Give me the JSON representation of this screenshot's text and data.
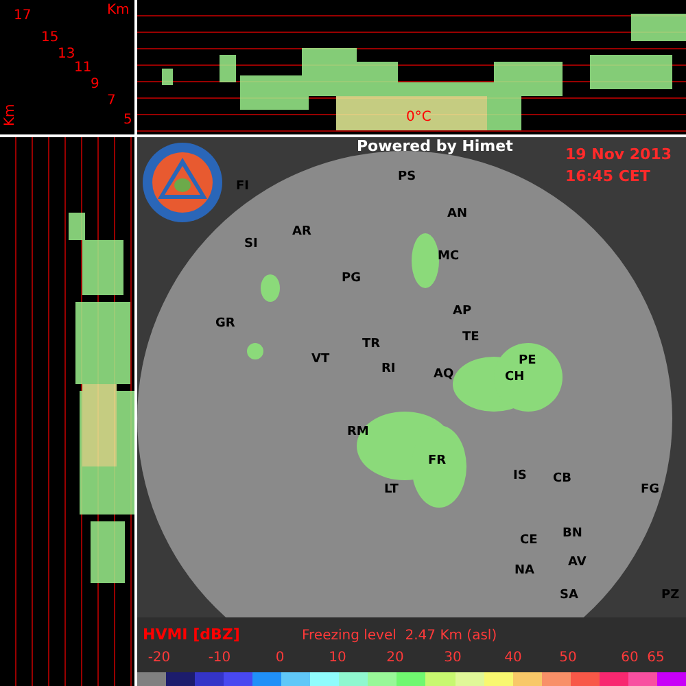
{
  "height_axis": {
    "unit": "Km",
    "side_unit": "Km",
    "labels": [
      "17",
      "15",
      "13",
      "11",
      "9",
      "7",
      "5"
    ]
  },
  "top_panel": {
    "freezing_marker": "0°C"
  },
  "map": {
    "credit": "Powered by Himet",
    "date": "19 Nov 2013",
    "time": "16:45 CET",
    "cities": [
      {
        "name": "FI"
      },
      {
        "name": "PS"
      },
      {
        "name": "AN"
      },
      {
        "name": "SI"
      },
      {
        "name": "AR"
      },
      {
        "name": "MC"
      },
      {
        "name": "PG"
      },
      {
        "name": "AP"
      },
      {
        "name": "GR"
      },
      {
        "name": "TE"
      },
      {
        "name": "TR"
      },
      {
        "name": "PE"
      },
      {
        "name": "VT"
      },
      {
        "name": "RI"
      },
      {
        "name": "AQ"
      },
      {
        "name": "CH"
      },
      {
        "name": "RM"
      },
      {
        "name": "FR"
      },
      {
        "name": "IS"
      },
      {
        "name": "CB"
      },
      {
        "name": "FG"
      },
      {
        "name": "LT"
      },
      {
        "name": "CE"
      },
      {
        "name": "BN"
      },
      {
        "name": "NA"
      },
      {
        "name": "AV"
      },
      {
        "name": "SA"
      },
      {
        "name": "PZ"
      }
    ]
  },
  "legend": {
    "product": "HVMI [dBZ]",
    "freezing_level": "Freezing level  2.47 Km (asl)",
    "ticks": [
      "-20",
      "-10",
      "0",
      "10",
      "20",
      "30",
      "40",
      "50",
      "60",
      "65"
    ],
    "segments": [
      {
        "color": "#808080"
      },
      {
        "color": "#1c1c6c"
      },
      {
        "color": "#3434c8"
      },
      {
        "color": "#4848f0"
      },
      {
        "color": "#2090f8"
      },
      {
        "color": "#60c8f8"
      },
      {
        "color": "#90fcfc"
      },
      {
        "color": "#90f8d0"
      },
      {
        "color": "#98f898"
      },
      {
        "color": "#70f870"
      },
      {
        "color": "#c8f870"
      },
      {
        "color": "#e0f898"
      },
      {
        "color": "#f8f870"
      },
      {
        "color": "#f8c868"
      },
      {
        "color": "#f89068"
      },
      {
        "color": "#f85848"
      },
      {
        "color": "#f82870"
      },
      {
        "color": "#f850a0"
      },
      {
        "color": "#c800f8"
      }
    ]
  }
}
